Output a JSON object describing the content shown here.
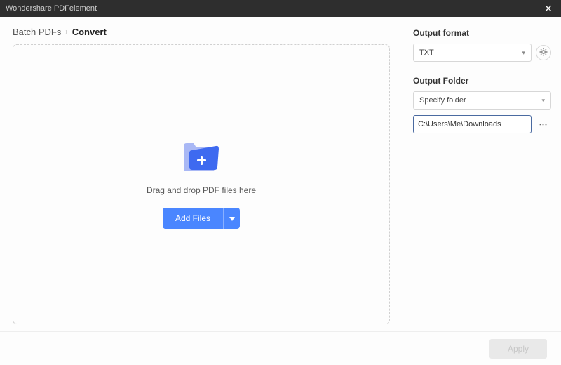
{
  "window": {
    "title": "Wondershare PDFelement"
  },
  "breadcrumb": {
    "parent": "Batch PDFs",
    "current": "Convert"
  },
  "dropzone": {
    "hint": "Drag and drop PDF files here",
    "add_files_label": "Add Files"
  },
  "side": {
    "output_format_label": "Output format",
    "output_format_value": "TXT",
    "output_folder_label": "Output Folder",
    "folder_mode_value": "Specify folder",
    "folder_path_value": "C:\\Users\\Me\\Downloads"
  },
  "footer": {
    "apply_label": "Apply"
  }
}
